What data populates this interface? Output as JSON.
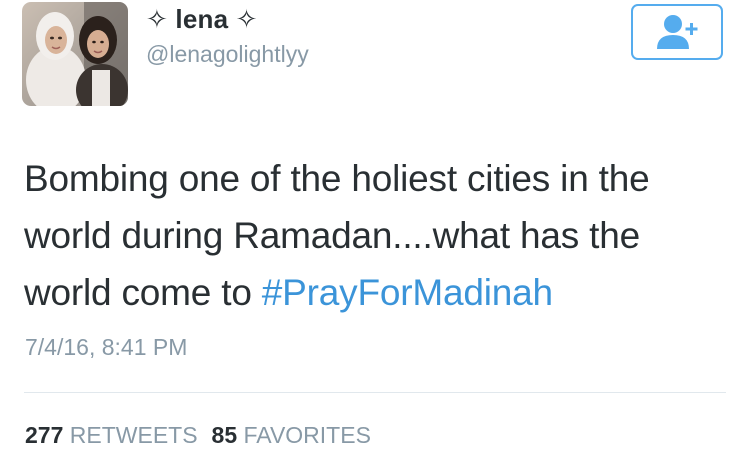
{
  "tweet": {
    "author": {
      "display_name": "✧ lena ✧",
      "username": "@lenagolightlyy",
      "avatar_icon": "profile-photo"
    },
    "follow_button": {
      "icon": "add-user-icon"
    },
    "text": "Bombing one of the holiest cities in the world during Ramadan....what has the world come to ",
    "hashtag": "#PrayForMadinah",
    "timestamp": "7/4/16, 8:41 PM",
    "stats": {
      "retweets_count": "277",
      "retweets_label": "RETWEETS",
      "favorites_count": "85",
      "favorites_label": "FAVORITES"
    }
  },
  "colors": {
    "accent": "#55acee",
    "hashtag": "#3b94d9",
    "secondary_text": "#8899a6",
    "primary_text": "#292f33",
    "divider": "#e1e8ed"
  }
}
